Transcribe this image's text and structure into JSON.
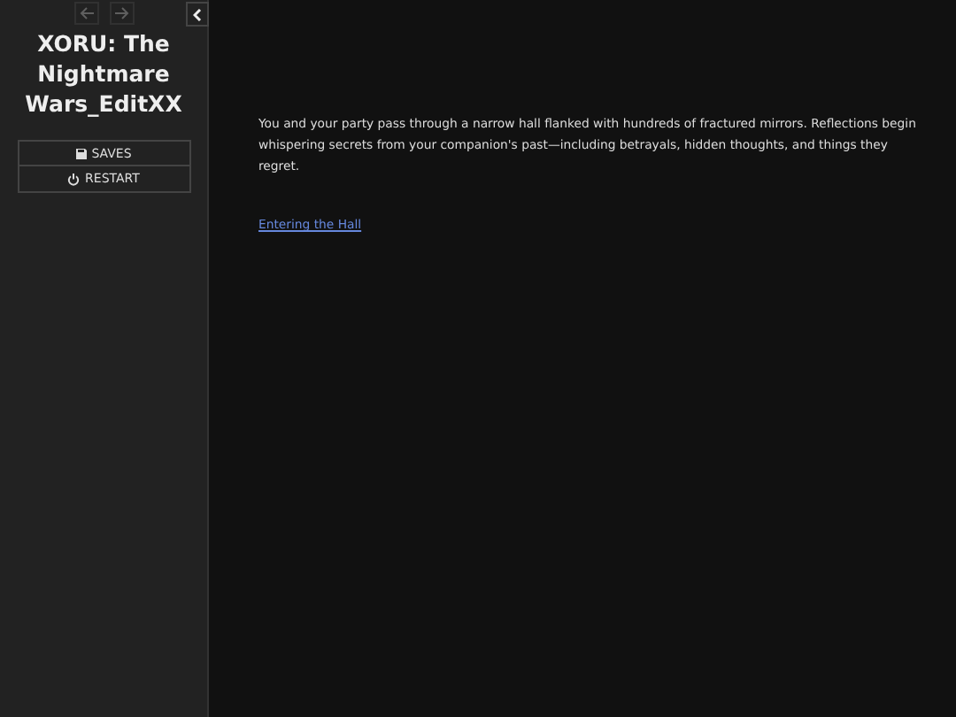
{
  "sidebar": {
    "history": [
      {
        "kind": "back",
        "disabled": true
      },
      {
        "kind": "forward",
        "disabled": true
      }
    ],
    "title": "XORU: The Nightmare Wars_EditXX",
    "menu": [
      {
        "kind": "saves",
        "label": "SAVES"
      },
      {
        "kind": "restart",
        "label": "RESTART"
      }
    ]
  },
  "passage": {
    "text": "You and your party pass through a narrow hall flanked with hundreds of fractured mirrors. Reflections begin whispering secrets from your companion's past—including betrayals, hidden thoughts, and things they regret.",
    "link": "Entering the Hall"
  }
}
